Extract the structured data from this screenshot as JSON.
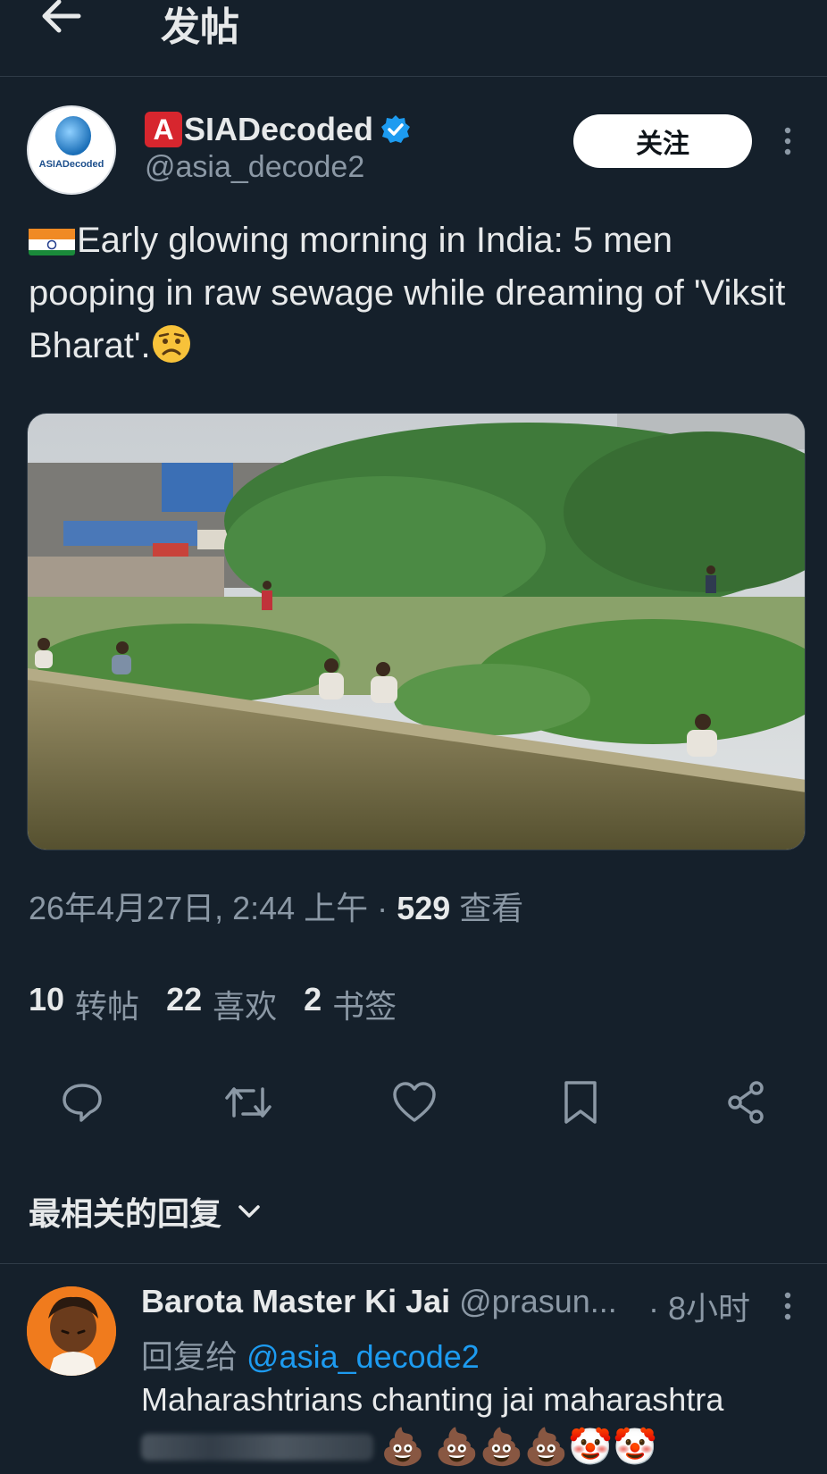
{
  "header": {
    "title": "发帖"
  },
  "author": {
    "avatar_text": "ASIADecoded",
    "badge_letter": "A",
    "display_name_rest": "SIADecoded",
    "handle": "@asia_decode2",
    "follow_label": "关注"
  },
  "tweet": {
    "text": "Early glowing morning in India: 5 men pooping in raw sewage while dreaming of 'Viksit Bharat'.",
    "timestamp": "26年4月27日, 2:44 上午 · ",
    "views_count": "529",
    "views_label": " 查看"
  },
  "stats": [
    {
      "count": "10",
      "label": "转帖"
    },
    {
      "count": "22",
      "label": "喜欢"
    },
    {
      "count": "2",
      "label": "书签"
    }
  ],
  "actions": [
    "reply-icon",
    "retweet-icon",
    "like-icon",
    "bookmark-icon",
    "share-icon"
  ],
  "replies": {
    "sort_label": "最相关的回复",
    "items": [
      {
        "name": "Barota Master Ki Jai",
        "handle": "@prasun...",
        "time": "· 8小时",
        "reply_to_prefix": "回复给 ",
        "reply_to_handle": "@asia_decode2",
        "text": "Maharashtrians chanting jai maharashtra",
        "emojis": "💩 💩💩💩🤡🤡"
      }
    ]
  },
  "colors": {
    "background": "#15202b",
    "accent": "#1d9bf0",
    "muted": "#8b98a5",
    "badge": "#d7262e"
  }
}
